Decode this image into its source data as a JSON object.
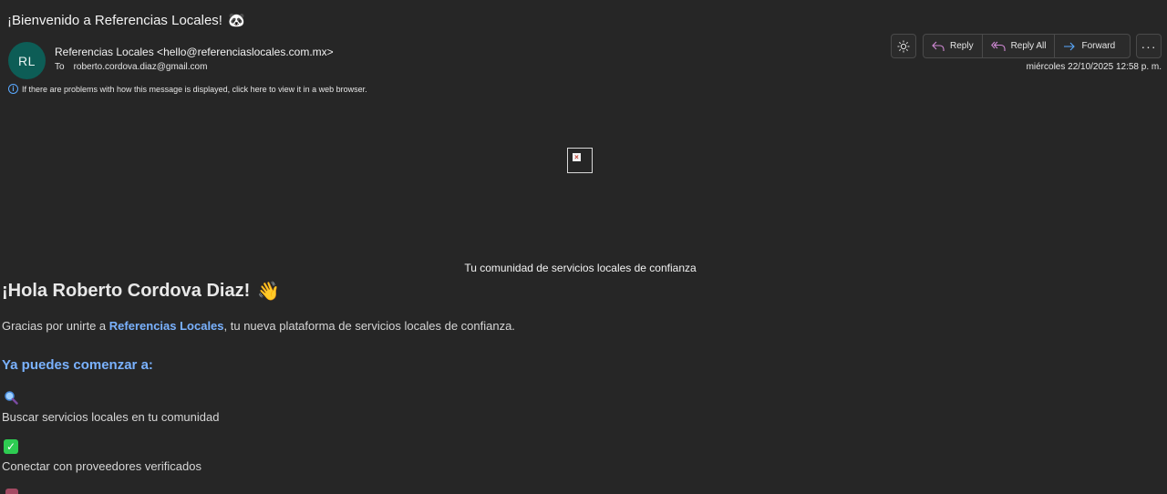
{
  "email": {
    "subject": "¡Bienvenido a Referencias Locales!",
    "subject_emoji": "🐼",
    "avatar_initials": "RL",
    "from": "Referencias Locales <hello@referenciaslocales.com.mx>",
    "to_label": "To",
    "to_address": "roberto.cordova.diaz@gmail.com",
    "info_message": "If there are problems with how this message is displayed, click here to view it in a web browser.",
    "date": "miércoles 22/10/2025 12:58 p. m."
  },
  "toolbar": {
    "theme_icon": "sun-icon",
    "reply_label": "Reply",
    "reply_all_label": "Reply All",
    "forward_label": "Forward",
    "more_icon": "more-icon"
  },
  "body": {
    "tagline": "Tu comunidad de servicios locales de confianza",
    "greeting": "¡Hola Roberto Cordova Diaz!",
    "greeting_emoji": "👋",
    "intro_before": "Gracias por unirte a ",
    "intro_brand": "Referencias Locales",
    "intro_after": ", tu nueva plataforma de servicios locales de confianza.",
    "start_heading": "Ya puedes comenzar a:",
    "features": [
      {
        "icon": "magnifier-icon",
        "text": "Buscar servicios locales en tu comunidad"
      },
      {
        "icon": "checkmark-icon",
        "text": "Conectar con proveedores verificados"
      }
    ]
  },
  "colors": {
    "background": "#262626",
    "accent_blue": "#7ab2ff",
    "avatar_bg": "#0d5d56",
    "check_green": "#2ecc52"
  }
}
